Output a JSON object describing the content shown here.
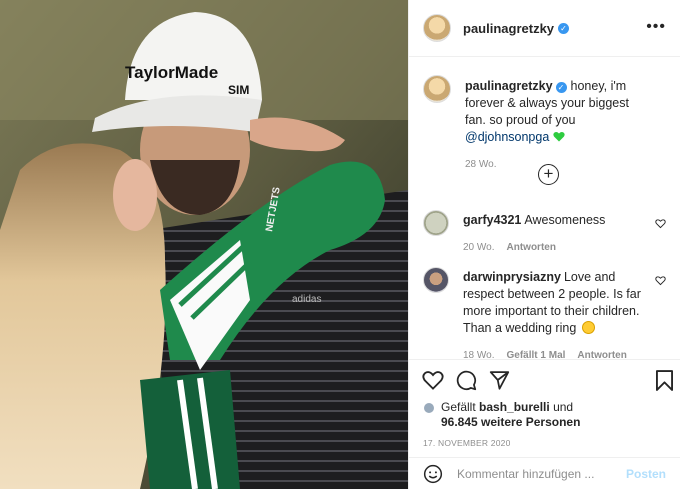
{
  "post": {
    "username": "paulinagretzky",
    "caption_user": "paulinagretzky",
    "caption_text": "honey, i'm forever & always your biggest fan. so proud of you",
    "caption_mention": "@djohnsonpga",
    "caption_age": "28 Wo.",
    "photo_cap_brand": "TaylorMade",
    "photo_cap_side": "SIM",
    "photo_sleeve_text": "NETJETS",
    "photo_shirt_text": "adidas"
  },
  "comments": [
    {
      "user": "garfy4321",
      "text": "Awesomeness",
      "age": "20 Wo.",
      "reply": "Antworten"
    },
    {
      "user": "darwinprysiazny",
      "text": "Love and respect between 2 people. Is far more important to their children. Than a wedding ring",
      "age": "18 Wo.",
      "likes": "Gefällt 1 Mal",
      "reply": "Antworten"
    }
  ],
  "likes": {
    "prefix": "Gefällt",
    "user": "bash_burelli",
    "middle": "und",
    "count": "96.845 weitere Personen"
  },
  "date": "17. NOVEMBER 2020",
  "add_comment": {
    "placeholder": "Kommentar hinzufügen ...",
    "post_label": "Posten"
  },
  "icons": [
    "more-icon",
    "verified-icon",
    "load-more-icon",
    "heart-icon",
    "comment-icon",
    "share-icon",
    "save-icon",
    "emoji-icon"
  ],
  "colors": {
    "verified": "#3897f0",
    "link": "#00376b",
    "post_disabled": "#b2dffc",
    "green_heart": "#2ecc40"
  }
}
